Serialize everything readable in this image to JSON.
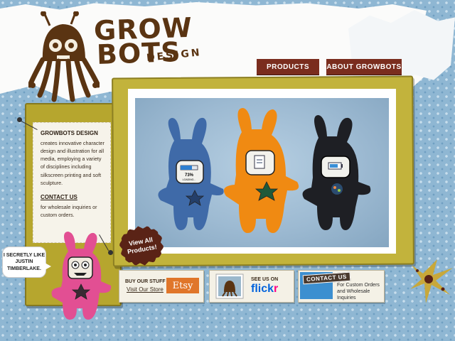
{
  "logo": {
    "line1": "GROW",
    "line2": "BOTS",
    "line3": "DESIGN"
  },
  "nav": {
    "products": "PRODUCTS",
    "about": "ABOUT GROWBOTS"
  },
  "sidebar": {
    "about_title": "GROWBOTS DESIGN",
    "about_text": "creates innovative character design and illustration for all media, employing a variety of disciplines including silkscreen printing and soft sculpture.",
    "contact_title": "CONTACT US",
    "contact_text": "for wholesale inquiries or custom orders."
  },
  "speech": {
    "text": "I SECRETLY LIKE JUSTIN TIMBERLAKE."
  },
  "hero": {
    "view_all": "View All Products!",
    "bot1_screen": "73%",
    "bot1_screen_sub": "LOADING..."
  },
  "bottom": {
    "etsy_line1": "BUY OUR STUFF",
    "etsy_line2": "Visit Our Store",
    "etsy_logo": "Etsy",
    "flickr_line1": "SEE US ON",
    "flickr_logo_a": "flick",
    "flickr_logo_b": "r",
    "contact_stamp": "CONTACT US",
    "contact_text": "For Custom Orders and Wholesale Inquiries"
  },
  "colors": {
    "nav_bg": "#7a2d1e",
    "olive": "#c2b33c",
    "bot_blue": "#3f6aa8",
    "bot_orange": "#f08a12",
    "bot_black": "#1e1f24",
    "bot_pink": "#e24f93"
  }
}
